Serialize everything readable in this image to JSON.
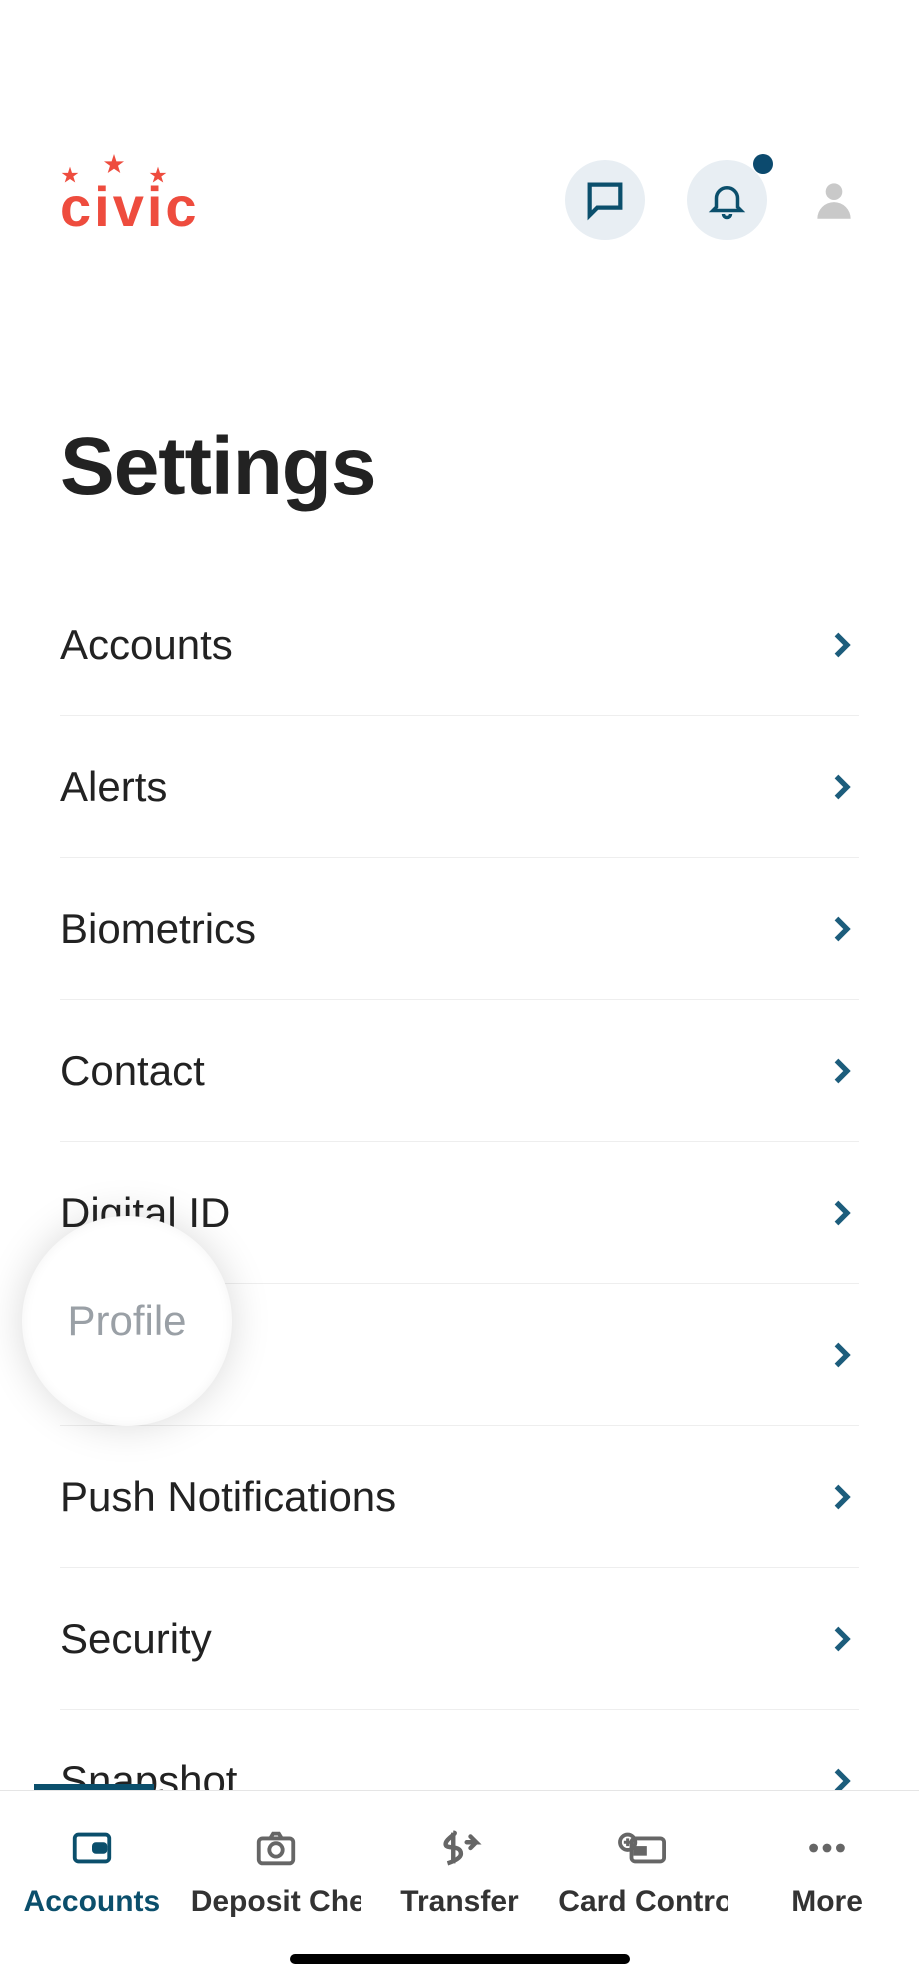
{
  "brand": {
    "text": "civic"
  },
  "header_icons": {
    "chat": "chat-icon",
    "bell": "bell-icon",
    "has_notification": true,
    "profile": "profile-icon"
  },
  "page_title": "Settings",
  "settings_items": [
    {
      "label": "Accounts"
    },
    {
      "label": "Alerts"
    },
    {
      "label": "Biometrics"
    },
    {
      "label": "Contact"
    },
    {
      "label": "Digital ID"
    },
    {
      "label": "Profile"
    },
    {
      "label": "Push Notifications"
    },
    {
      "label": "Security"
    },
    {
      "label": "Snapshot"
    }
  ],
  "highlighted_item_label": "Profile",
  "tabs": [
    {
      "label": "Accounts",
      "active": true
    },
    {
      "label": "Deposit Check",
      "active": false
    },
    {
      "label": "Transfer",
      "active": false
    },
    {
      "label": "Card Controls",
      "active": false
    },
    {
      "label": "More",
      "active": false
    }
  ],
  "colors": {
    "accent": "#0b4f6c",
    "brand": "#ee4c3e"
  }
}
